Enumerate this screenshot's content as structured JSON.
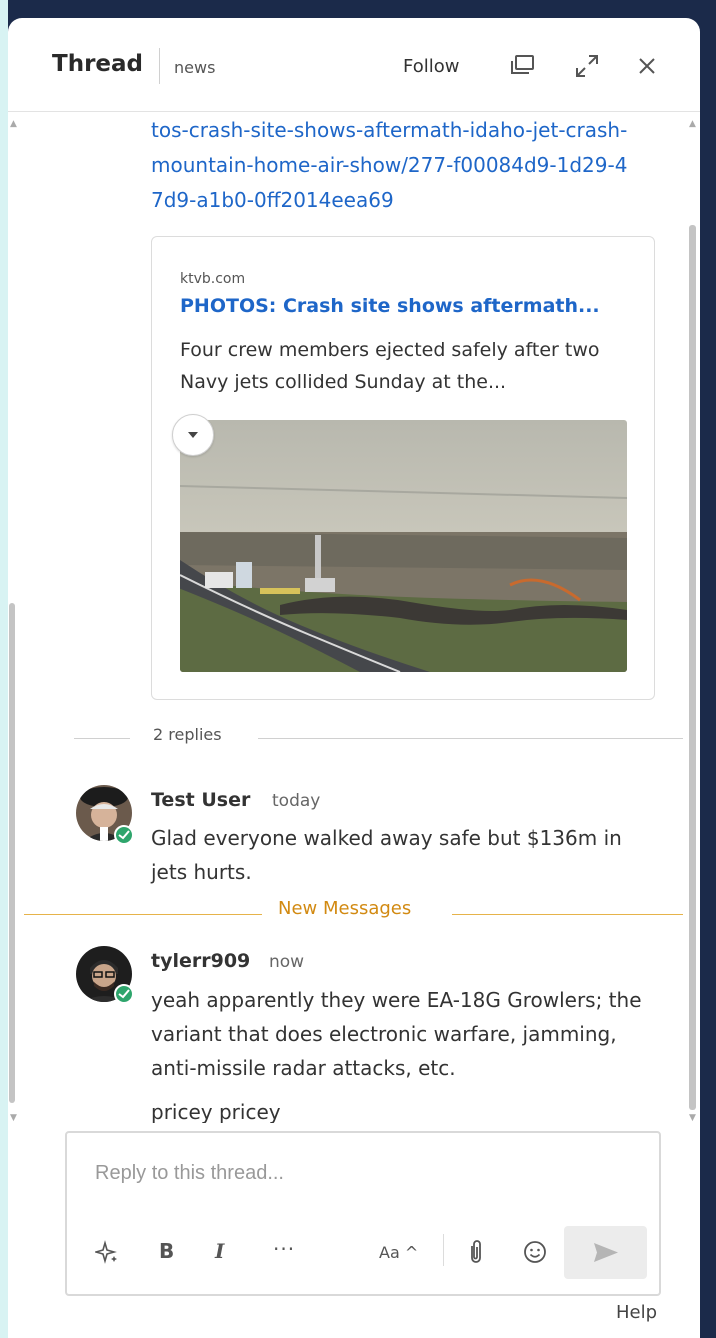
{
  "header": {
    "title": "Thread",
    "channel": "news",
    "follow_label": "Follow"
  },
  "thread": {
    "link_text": "tos-crash-site-shows-aftermath-idaho-jet-crash-mountain-home-air-show/277-f00084d9-1d29-47d9-a1b0-0ff2014eea69",
    "preview": {
      "domain": "ktvb.com",
      "title": "PHOTOS: Crash site shows aftermath...",
      "description": "Four crew members ejected safely after two Navy jets collided Sunday at the..."
    },
    "replies_label": "2 replies",
    "new_messages_label": "New Messages"
  },
  "messages": [
    {
      "name": "Test User",
      "time": "today",
      "text": "Glad everyone walked away safe but $136m in jets hurts."
    },
    {
      "name": "tylerr909",
      "time": "now",
      "text": "yeah apparently they were EA-18G Growlers; the variant that does electronic warfare, jamming, anti-missile radar attacks, etc.",
      "text2": "pricey pricey"
    }
  ],
  "composer": {
    "placeholder": "Reply to this thread...",
    "font_toggle": "Aa ^",
    "help": "Help"
  },
  "colors": {
    "link": "#1e66c8",
    "online": "#2ea56c",
    "new_messages": "#d28a12",
    "frame": "#1b2a4a"
  },
  "icons": [
    "popout-icon",
    "expand-icon",
    "close-icon",
    "sparkle-icon",
    "bold-icon",
    "italic-icon",
    "more-icon",
    "attach-icon",
    "emoji-icon",
    "send-icon",
    "dropdown-caret-icon"
  ]
}
